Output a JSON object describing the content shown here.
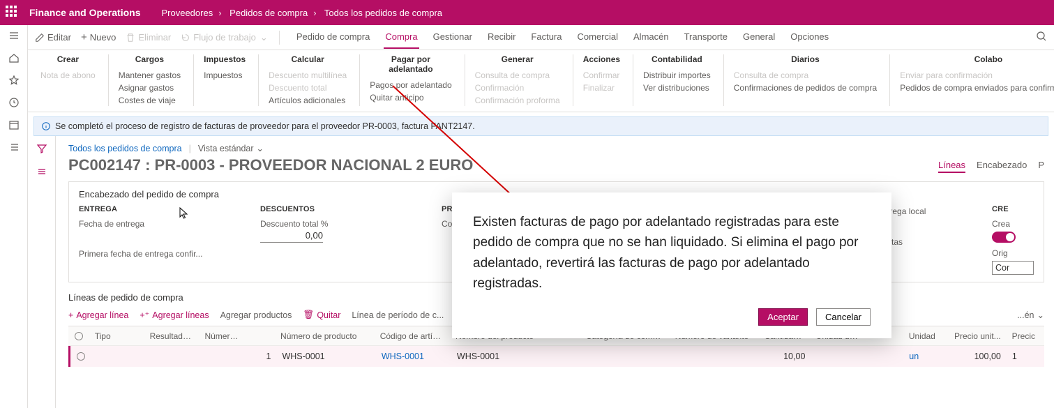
{
  "topbar": {
    "title": "Finance and Operations",
    "breadcrumbs": [
      "Proveedores",
      "Pedidos de compra",
      "Todos los pedidos de compra"
    ]
  },
  "cmdbar": {
    "edit": "Editar",
    "new": "Nuevo",
    "delete": "Eliminar",
    "workflow": "Flujo de trabajo",
    "tabs": [
      "Pedido de compra",
      "Compra",
      "Gestionar",
      "Recibir",
      "Factura",
      "Comercial",
      "Almacén",
      "Transporte",
      "General",
      "Opciones"
    ]
  },
  "ribbon": {
    "groups": [
      {
        "head": "Crear",
        "items": [
          {
            "t": "Nota de abono",
            "d": true
          }
        ]
      },
      {
        "head": "Cargos",
        "items": [
          {
            "t": "Mantener gastos"
          },
          {
            "t": "Asignar gastos"
          },
          {
            "t": "Costes de viaje"
          }
        ]
      },
      {
        "head": "Impuestos",
        "items": [
          {
            "t": "Impuestos"
          }
        ]
      },
      {
        "head": "Calcular",
        "items": [
          {
            "t": "Descuento multilínea",
            "d": true
          },
          {
            "t": "Descuento total",
            "d": true
          },
          {
            "t": "Artículos adicionales"
          }
        ]
      },
      {
        "head": "Pagar por adelantado",
        "items": [
          {
            "t": "Pagos por adelantado"
          },
          {
            "t": "Quitar anticipo"
          }
        ]
      },
      {
        "head": "Generar",
        "items": [
          {
            "t": "Consulta de compra",
            "d": true
          },
          {
            "t": "Confirmación",
            "d": true
          },
          {
            "t": "Confirmación proforma",
            "d": true
          }
        ]
      },
      {
        "head": "Acciones",
        "items": [
          {
            "t": "Confirmar",
            "d": true
          },
          {
            "t": "Finalizar",
            "d": true
          }
        ]
      },
      {
        "head": "Contabilidad",
        "items": [
          {
            "t": "Distribuir importes"
          },
          {
            "t": "Ver distribuciones"
          }
        ]
      },
      {
        "head": "Diarios",
        "items": [
          {
            "t": "Consulta de compra",
            "d": true
          },
          {
            "t": "Confirmaciones de pedidos de compra"
          }
        ]
      },
      {
        "head": "Colabo",
        "items": [
          {
            "t": "Enviar para confirmación",
            "d": true
          },
          {
            "t": "Pedidos de compra enviados para confirmación"
          }
        ]
      }
    ]
  },
  "info": "Se completó el proceso de registro de facturas de proveedor para el proveedor PR-0003, factura FANT2147.",
  "crumb": {
    "all": "Todos los pedidos de compra",
    "view": "Vista estándar"
  },
  "pageTitle": "PC002147 : PR-0003 - PROVEEDOR NACIONAL 2 EURO",
  "viewTabs": {
    "lines": "Líneas",
    "header": "Encabezado",
    "p": "P"
  },
  "headerPanel": {
    "title": "Encabezado del pedido de compra",
    "entrega": {
      "head": "ENTREGA",
      "f1": "Fecha de entrega",
      "f2": "Primera fecha de entrega confir..."
    },
    "descuentos": {
      "head": "DESCUENTOS",
      "f1": "Descuento total %",
      "v1": "0,00"
    },
    "proveedor": {
      "head": "PROVEEDOR",
      "f1": "Contacto"
    },
    "zona": {
      "f1": "...a de entrega local",
      "f2": "...a de ventas"
    },
    "cre": {
      "head": "CRE",
      "f1": "Crea",
      "f2": "Orig",
      "sel": "Cor"
    }
  },
  "linesPanel": {
    "title": "Líneas de pedido de compra",
    "toolbar": {
      "add": "Agregar línea",
      "addm": "Agregar líneas",
      "addp": "Agregar productos",
      "rem": "Quitar",
      "per": "Línea de período de c...",
      "n": "...én"
    },
    "headers": [
      "Tipo",
      "Resultados...",
      "Número d...",
      "",
      "Número de producto",
      "Código de artículo",
      "Nombre del producto",
      "Categoría de compras",
      "Número de variante",
      "Cantidad PC",
      "Unidad de ...",
      "",
      "Unidad",
      "Precio unit...",
      "Precic"
    ],
    "row": {
      "numl": "1",
      "npr": "WHS-0001",
      "cod": "WHS-0001",
      "nom": "WHS-0001",
      "cpc": "10,00",
      "un": "un",
      "pu": "100,00",
      "p2": "1"
    }
  },
  "modal": {
    "text": "Existen facturas de pago por adelantado registradas para este pedido de compra que no se han liquidado. Si elimina el pago por adelantado, revertirá las facturas de pago por adelantado registradas.",
    "accept": "Aceptar",
    "cancel": "Cancelar"
  }
}
